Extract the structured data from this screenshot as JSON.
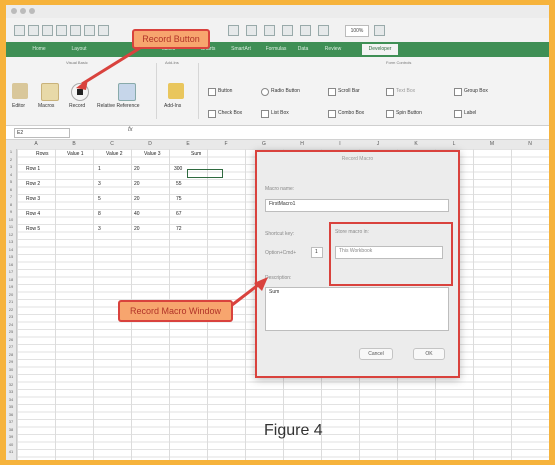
{
  "callouts": {
    "record_button": "Record Button",
    "record_macro_window": "Record Macro Window"
  },
  "figure_caption": "Figure 4",
  "qat": {
    "zoom": "100%"
  },
  "ribbon": {
    "tabs": [
      "Home",
      "Layout",
      "Tables",
      "Charts",
      "SmartArt",
      "Formulas",
      "Data",
      "Review",
      "Developer"
    ],
    "active_tab": "Developer",
    "groups": [
      "Visual Basic",
      "Add-Ins",
      "Form Controls"
    ],
    "buttons": [
      "Editor",
      "Macros",
      "Record",
      "Relative Reference",
      "Add-Ins"
    ],
    "controls": [
      "Button",
      "Check Box",
      "Radio Button",
      "List Box",
      "Scroll Bar",
      "Combo Box",
      "Text Box",
      "Spin Button",
      "Group Box",
      "Label"
    ]
  },
  "formula_bar": {
    "name_box": "E2",
    "fx": "fx"
  },
  "columns": [
    "A",
    "B",
    "C",
    "D",
    "E",
    "F",
    "G",
    "H",
    "I",
    "J",
    "K",
    "L",
    "M",
    "N"
  ],
  "table": {
    "headers": [
      "Rows",
      "Value 1",
      "Value 2",
      "Value 3",
      "Sum"
    ],
    "rows": [
      [
        "Row 1",
        "1",
        "20",
        "300",
        ""
      ],
      [
        "Row 2",
        "3",
        "20",
        "55",
        ""
      ],
      [
        "Row 3",
        "5",
        "20",
        "75",
        ""
      ],
      [
        "Row 4",
        "8",
        "40",
        "67",
        ""
      ],
      [
        "Row 5",
        "3",
        "20",
        "72",
        ""
      ]
    ]
  },
  "dialog": {
    "title": "Record Macro",
    "macro_name_label": "Macro name:",
    "macro_name_value": "FirstMacro1",
    "shortcut_label": "Shortcut key:",
    "option_label": "Option+Cmd+",
    "option_value": "1",
    "store_label": "Store macro in:",
    "store_value": "This Workbook",
    "description_label": "Description:",
    "description_value": "Sum",
    "cancel": "Cancel",
    "ok": "OK"
  },
  "colors": {
    "ribbon_green": "#3f8f55",
    "callout_red": "#d9423d",
    "callout_fill": "#f7a56e",
    "frame": "#f6b33c"
  }
}
